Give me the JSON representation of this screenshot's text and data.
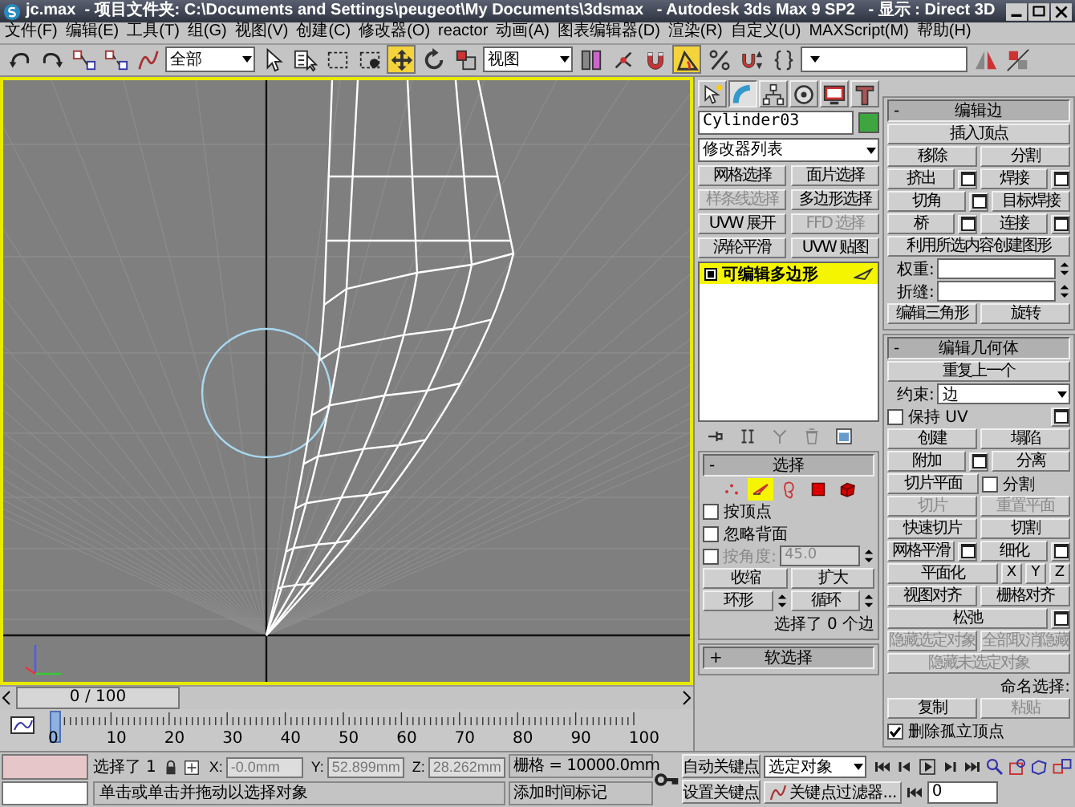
{
  "window": {
    "title": "jc.max  - 项目文件夹: C:\\Documents and Settings\\peugeot\\My Documents\\3dsmax   - Autodesk 3ds Max 9 SP2   - 显示 : Direct 3D"
  },
  "menu": [
    {
      "label": "文件(F)"
    },
    {
      "label": "编辑(E)"
    },
    {
      "label": "工具(T)"
    },
    {
      "label": "组(G)"
    },
    {
      "label": "视图(V)"
    },
    {
      "label": "创建(C)"
    },
    {
      "label": "修改器(O)"
    },
    {
      "label": "reactor"
    },
    {
      "label": "动画(A)"
    },
    {
      "label": "图表编辑器(D)"
    },
    {
      "label": "渲染(R)"
    },
    {
      "label": "自定义(U)"
    },
    {
      "label": "MAXScript(M)"
    },
    {
      "label": "帮助(H)"
    }
  ],
  "toolbar": [
    {
      "kind": "undo",
      "selected": false
    },
    {
      "kind": "redo",
      "selected": false
    },
    {
      "kind": "link",
      "selected": false
    },
    {
      "kind": "unlink",
      "selected": false
    },
    {
      "kind": "bind",
      "selected": false
    },
    {
      "kind": "dropdown",
      "value": "全部"
    },
    {
      "kind": "select",
      "selected": false
    },
    {
      "kind": "select-name",
      "selected": false
    },
    {
      "kind": "region",
      "selected": false
    },
    {
      "kind": "crossing",
      "selected": false
    },
    {
      "kind": "move",
      "selected": true
    },
    {
      "kind": "rotate",
      "selected": false
    },
    {
      "kind": "scale",
      "selected": false
    },
    {
      "kind": "dropdown",
      "value": "视图"
    },
    {
      "kind": "pivot",
      "selected": false
    },
    {
      "kind": "manipulate",
      "selected": false
    },
    {
      "kind": "snap",
      "selected": false
    },
    {
      "kind": "angle-snap",
      "selected": true
    },
    {
      "kind": "percent-snap",
      "selected": false
    },
    {
      "kind": "spinner-snap",
      "selected": false
    },
    {
      "kind": "named-selection",
      "selected": false
    },
    {
      "kind": "dropdown"
    },
    {
      "kind": "mirror",
      "selected": false
    },
    {
      "kind": "align",
      "selected": false
    }
  ],
  "timeline": {
    "position": "0 / 100",
    "level": 0,
    "ruler_labels": [
      "0",
      "10",
      "20",
      "30",
      "40",
      "50",
      "60",
      "70",
      "80",
      "90",
      "100"
    ]
  },
  "panel": {
    "tabs": [
      {
        "kind": "create",
        "selected": false
      },
      {
        "kind": "modify",
        "selected": true
      },
      {
        "kind": "hierarchy",
        "selected": false
      },
      {
        "kind": "motion",
        "selected": false
      },
      {
        "kind": "display",
        "selected": false
      },
      {
        "kind": "utilities",
        "selected": false
      }
    ],
    "object_name": "Cylinder03",
    "modifier_list": "修改器列表",
    "modifier_buttons": [
      {
        "label": "网格选择",
        "disabled": false
      },
      {
        "label": "面片选择",
        "disabled": false
      },
      {
        "label": "样条线选择",
        "disabled": true
      },
      {
        "label": "多边形选择",
        "disabled": false
      },
      {
        "label": "UVW 展开",
        "disabled": false
      },
      {
        "label": "FFD 选择",
        "disabled": true
      },
      {
        "label": "涡轮平滑",
        "disabled": false
      },
      {
        "label": "UVW 贴图",
        "disabled": false
      }
    ],
    "stack": [
      {
        "label": "可编辑多边形",
        "selected": true
      }
    ],
    "stack_tools": [
      {
        "kind": "pin",
        "disabled": false
      },
      {
        "kind": "end-result",
        "disabled": false
      },
      {
        "kind": "unique",
        "disabled": true
      },
      {
        "kind": "remove",
        "disabled": true
      },
      {
        "kind": "configure",
        "disabled": false
      }
    ],
    "columns": [
      [
        {
          "sign": "-",
          "title": "选择",
          "rows": [
            [
              {
                "kind": "subobjects",
                "items": [
                  {
                    "kind": "vertex",
                    "selected": false
                  },
                  {
                    "kind": "edge",
                    "selected": true
                  },
                  {
                    "kind": "border",
                    "selected": false
                  },
                  {
                    "kind": "polygon",
                    "selected": false
                  },
                  {
                    "kind": "element",
                    "selected": false
                  }
                ]
              }
            ],
            [
              {
                "kind": "checkbox",
                "label": "按顶点",
                "checked": false,
                "disabled": false
              }
            ],
            [
              {
                "kind": "checkbox",
                "label": "忽略背面",
                "checked": false,
                "disabled": false
              }
            ],
            [
              {
                "kind": "checkbox",
                "label": "按角度:",
                "checked": false,
                "disabled": true
              },
              {
                "kind": "spinner",
                "value": "45.0",
                "disabled": true
              }
            ],
            [
              {
                "kind": "button",
                "label": "收缩",
                "disabled": false
              },
              {
                "kind": "button",
                "label": "扩大",
                "disabled": false
              }
            ],
            [
              {
                "kind": "spin-button",
                "label": "环形",
                "disabled": false
              },
              {
                "kind": "spin-button",
                "label": "循环",
                "disabled": false
              }
            ],
            [
              {
                "kind": "text",
                "label": "选择了 0 个边"
              }
            ]
          ]
        },
        {
          "sign": "+",
          "title": "软选择"
        }
      ],
      [
        {
          "sign": "-",
          "title": "编辑边",
          "rows": [
            [
              {
                "kind": "button",
                "label": "插入顶点",
                "disabled": false
              }
            ],
            [
              {
                "kind": "button",
                "label": "移除",
                "disabled": false
              },
              {
                "kind": "button",
                "label": "分割",
                "disabled": false
              }
            ],
            [
              {
                "kind": "option-button",
                "label": "挤出",
                "disabled": false
              },
              {
                "kind": "option-button",
                "label": "焊接",
                "disabled": false
              }
            ],
            [
              {
                "kind": "option-button",
                "label": "切角",
                "disabled": false
              },
              {
                "kind": "button",
                "label": "目标焊接",
                "disabled": false
              }
            ],
            [
              {
                "kind": "option-button",
                "label": "桥",
                "disabled": false
              },
              {
                "kind": "option-button",
                "label": "连接",
                "disabled": false
              }
            ],
            [
              {
                "kind": "button",
                "label": "利用所选内容创建图形",
                "disabled": false
              }
            ],
            [
              {
                "kind": "spinner",
                "label": "权重:",
                "disabled": false
              }
            ],
            [
              {
                "kind": "spinner",
                "label": "折缝:",
                "disabled": false
              }
            ],
            [
              {
                "kind": "button",
                "label": "编辑三角形",
                "disabled": false
              },
              {
                "kind": "button",
                "label": "旋转",
                "disabled": false
              }
            ]
          ]
        },
        {
          "sign": "-",
          "title": "编辑几何体",
          "rows": [
            [
              {
                "kind": "button",
                "label": "重复上一个",
                "disabled": false
              }
            ],
            [
              {
                "kind": "dropdown",
                "label": "约束:",
                "value": "边"
              }
            ],
            [
              {
                "kind": "option-checkbox",
                "label": "保持 UV",
                "checked": false,
                "disabled": false
              }
            ],
            [
              {
                "kind": "button",
                "label": "创建",
                "disabled": false
              },
              {
                "kind": "button",
                "label": "塌陷",
                "disabled": false
              }
            ],
            [
              {
                "kind": "option-button",
                "label": "附加",
                "disabled": false
              },
              {
                "kind": "button",
                "label": "分离",
                "disabled": false
              }
            ],
            [
              {
                "kind": "button",
                "label": "切片平面",
                "disabled": false
              },
              {
                "kind": "checkbox",
                "label": "分割",
                "checked": false,
                "disabled": false
              }
            ],
            [
              {
                "kind": "button",
                "label": "切片",
                "disabled": true
              },
              {
                "kind": "button",
                "label": "重置平面",
                "disabled": true
              }
            ],
            [
              {
                "kind": "button",
                "label": "快速切片",
                "disabled": false
              },
              {
                "kind": "button",
                "label": "切割",
                "disabled": false
              }
            ],
            [
              {
                "kind": "option-button",
                "label": "网格平滑",
                "disabled": false
              },
              {
                "kind": "option-button",
                "label": "细化",
                "disabled": false
              }
            ],
            [
              {
                "kind": "button",
                "label": "平面化",
                "disabled": false
              },
              {
                "kind": "axis",
                "label": "X"
              },
              {
                "kind": "axis",
                "label": "Y"
              },
              {
                "kind": "axis",
                "label": "Z"
              }
            ],
            [
              {
                "kind": "button",
                "label": "视图对齐",
                "disabled": false
              },
              {
                "kind": "button",
                "label": "栅格对齐",
                "disabled": false
              }
            ],
            [
              {
                "kind": "option-button",
                "label": "松弛",
                "disabled": false
              }
            ],
            [
              {
                "kind": "button",
                "label": "隐藏选定对象",
                "disabled": true
              },
              {
                "kind": "button",
                "label": "全部取消隐藏",
                "disabled": true
              }
            ],
            [
              {
                "kind": "button",
                "label": "隐藏未选定对象",
                "disabled": true
              }
            ],
            [
              {
                "kind": "text",
                "label": "命名选择:"
              }
            ],
            [
              {
                "kind": "button",
                "label": "复制",
                "disabled": false
              },
              {
                "kind": "button",
                "label": "粘贴",
                "disabled": true
              }
            ],
            [
              {
                "kind": "checkbox",
                "label": "删除孤立顶点",
                "checked": true,
                "disabled": false
              }
            ]
          ]
        }
      ]
    ]
  },
  "status": {
    "selection": "选择了 1",
    "x_label": "X:",
    "x": "-0.0mm",
    "y_label": "Y:",
    "y": "52.899mm",
    "z_label": "Z:",
    "z": "28.262mm",
    "grid": "栅格 = 10000.0mm",
    "prompt": "单击或单击并拖动以选择对象",
    "time_tag": "添加时间标记",
    "auto_key": "自动关键点",
    "set_key": "设置关键点",
    "key_target": "选定对象",
    "key_filters": "关键点过滤器...",
    "frame": "0"
  }
}
